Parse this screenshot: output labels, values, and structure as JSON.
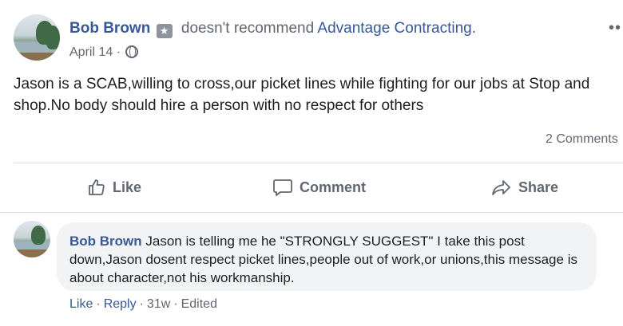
{
  "post": {
    "author": "Bob Brown",
    "recommend_text": "doesn't recommend",
    "page_name": "Advantage Contracting.",
    "date": "April 14",
    "meta_sep": "·",
    "more": "••",
    "body": "Jason is a SCAB,willing to cross,our picket lines while fighting for our jobs at Stop and shop.No body should hire a person with no respect for others",
    "comments_count": "2 Comments"
  },
  "actions": {
    "like": "Like",
    "comment": "Comment",
    "share": "Share"
  },
  "comment": {
    "author": "Bob Brown",
    "text": "Jason is telling me he \"STRONGLY SUGGEST\" I take this post down,Jason dosent respect picket lines,people out of work,or unions,this message is about character,not his workmanship.",
    "like": "Like",
    "reply": "Reply",
    "age": "31w",
    "edited": "Edited",
    "sep": "·"
  },
  "colors": {
    "link": "#385898",
    "muted": "#606770",
    "bubble": "#f2f3f5",
    "divider": "#dadde1"
  }
}
